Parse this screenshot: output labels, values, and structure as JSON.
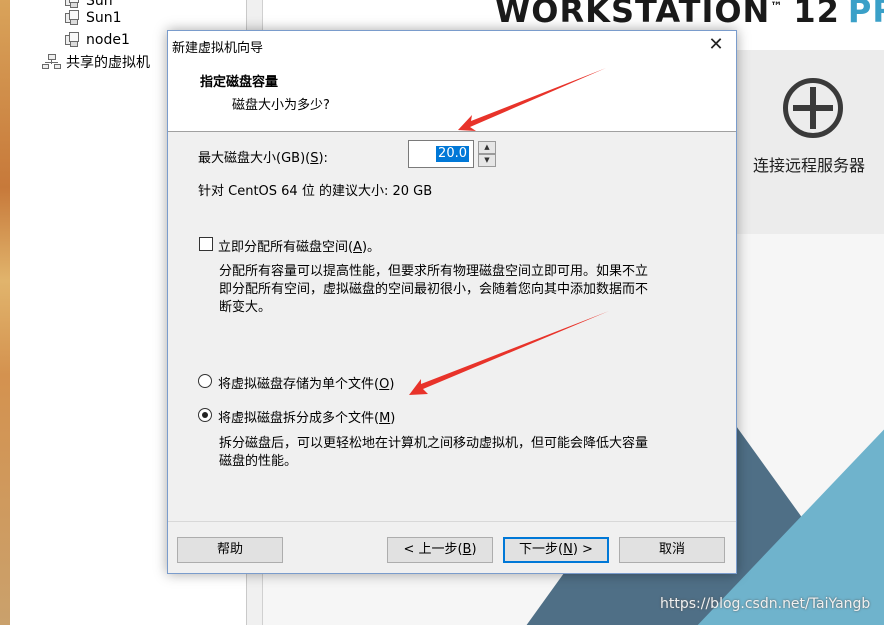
{
  "tree": {
    "items": [
      {
        "label": "Sun"
      },
      {
        "label": "Sun1"
      },
      {
        "label": "node1"
      }
    ],
    "shared_label": "共享的虚拟机"
  },
  "home": {
    "brand_word": "WORKSTATION",
    "brand_tm": "™",
    "brand_version": "12",
    "brand_edition": "PR",
    "remote_label": "连接远程服务器"
  },
  "dialog": {
    "title": "新建虚拟机向导",
    "close_glyph": "✕",
    "header_title": "指定磁盘容量",
    "header_subtitle": "磁盘大小为多少?",
    "max_size_label_prefix": "最大磁盘大小(GB)(",
    "max_size_label_key": "S",
    "max_size_label_suffix": "):",
    "max_size_value": "20.0",
    "recommended_text": "针对 CentOS 64 位 的建议大小: 20 GB",
    "allocate_label_prefix": "立即分配所有磁盘空间(",
    "allocate_label_key": "A",
    "allocate_label_suffix": ")。",
    "allocate_checked": false,
    "allocate_desc_line1": "分配所有容量可以提高性能，但要求所有物理磁盘空间立即可用。如果不立",
    "allocate_desc_line2": "即分配所有空间，虚拟磁盘的空间最初很小，会随着您向其中添加数据而不",
    "allocate_desc_line3": "断变大。",
    "single_file_label_prefix": "将虚拟磁盘存储为单个文件(",
    "single_file_label_key": "O",
    "single_file_label_suffix": ")",
    "multi_file_label_prefix": "将虚拟磁盘拆分成多个文件(",
    "multi_file_label_key": "M",
    "multi_file_label_suffix": ")",
    "selected_storage": "multi",
    "multi_desc_line1": "拆分磁盘后，可以更轻松地在计算机之间移动虚拟机，但可能会降低大容量",
    "multi_desc_line2": "磁盘的性能。",
    "buttons": {
      "help": "帮助",
      "back_prefix": "< 上一步(",
      "back_key": "B",
      "back_suffix": ")",
      "next_prefix": "下一步(",
      "next_key": "N",
      "next_suffix": ") >",
      "cancel": "取消"
    }
  },
  "watermark": "https://blog.csdn.net/TaiYangb",
  "colors": {
    "selection": "#0078d7",
    "annotation_arrow": "#e8332a",
    "brand_accent": "#3aa0c8"
  }
}
